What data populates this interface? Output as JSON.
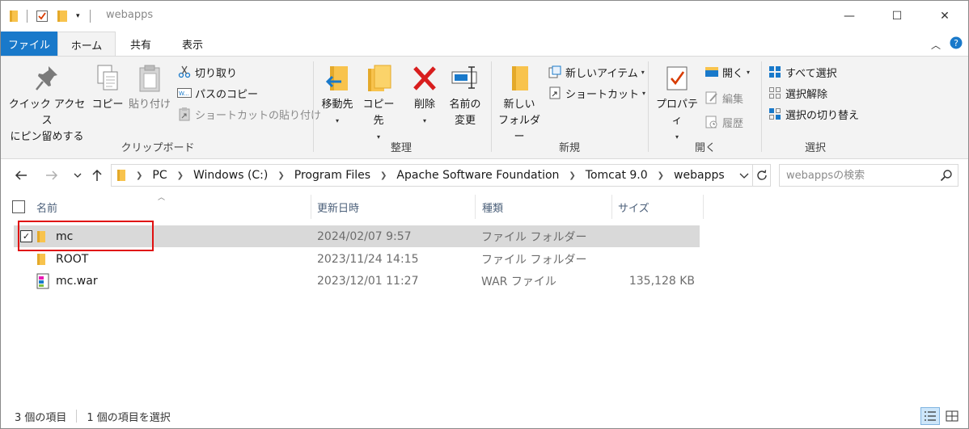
{
  "window": {
    "title": "webapps",
    "minimize_glyph": "—",
    "maximize_glyph": "☐",
    "close_glyph": "✕"
  },
  "tabs": {
    "file": "ファイル",
    "home": "ホーム",
    "share": "共有",
    "view": "表示"
  },
  "ribbon": {
    "clipboard": {
      "label": "クリップボード",
      "pin_line1": "クイック アクセス",
      "pin_line2": "にピン留めする",
      "copy": "コピー",
      "paste": "貼り付け",
      "cut": "切り取り",
      "copy_path": "パスのコピー",
      "paste_shortcut": "ショートカットの貼り付け"
    },
    "organize": {
      "label": "整理",
      "move_to": "移動先",
      "copy_to": "コピー先",
      "delete": "削除",
      "rename_line1": "名前の",
      "rename_line2": "変更"
    },
    "new": {
      "label": "新規",
      "new_folder_line1": "新しい",
      "new_folder_line2": "フォルダー",
      "new_item": "新しいアイテム",
      "shortcut": "ショートカット"
    },
    "open": {
      "label": "開く",
      "properties": "プロパティ",
      "open": "開く",
      "edit": "編集",
      "history": "履歴"
    },
    "select": {
      "label": "選択",
      "select_all": "すべて選択",
      "select_none": "選択解除",
      "invert": "選択の切り替え"
    }
  },
  "address": {
    "crumbs": [
      "PC",
      "Windows (C:)",
      "Program Files",
      "Apache Software Foundation",
      "Tomcat 9.0",
      "webapps"
    ]
  },
  "search": {
    "placeholder": "webappsの検索"
  },
  "columns": {
    "name": "名前",
    "date": "更新日時",
    "type": "種類",
    "size": "サイズ"
  },
  "files": [
    {
      "name": "mc",
      "date": "2024/02/07 9:57",
      "type": "ファイル フォルダー",
      "size": "",
      "icon": "folder-icon",
      "selected": true
    },
    {
      "name": "ROOT",
      "date": "2023/11/24 14:15",
      "type": "ファイル フォルダー",
      "size": "",
      "icon": "folder-icon",
      "selected": false
    },
    {
      "name": "mc.war",
      "date": "2023/12/01 11:27",
      "type": "WAR ファイル",
      "size": "135,128 KB",
      "icon": "war-file-icon",
      "selected": false
    }
  ],
  "status": {
    "item_count": "3 個の項目",
    "selected_count": "1 個の項目を選択"
  },
  "colors": {
    "file_tab": "#1979ca",
    "folder": "#f8c34d",
    "delete": "#d81e1e",
    "highlight": "#e01010",
    "selected_row": "#d9d9d9"
  }
}
